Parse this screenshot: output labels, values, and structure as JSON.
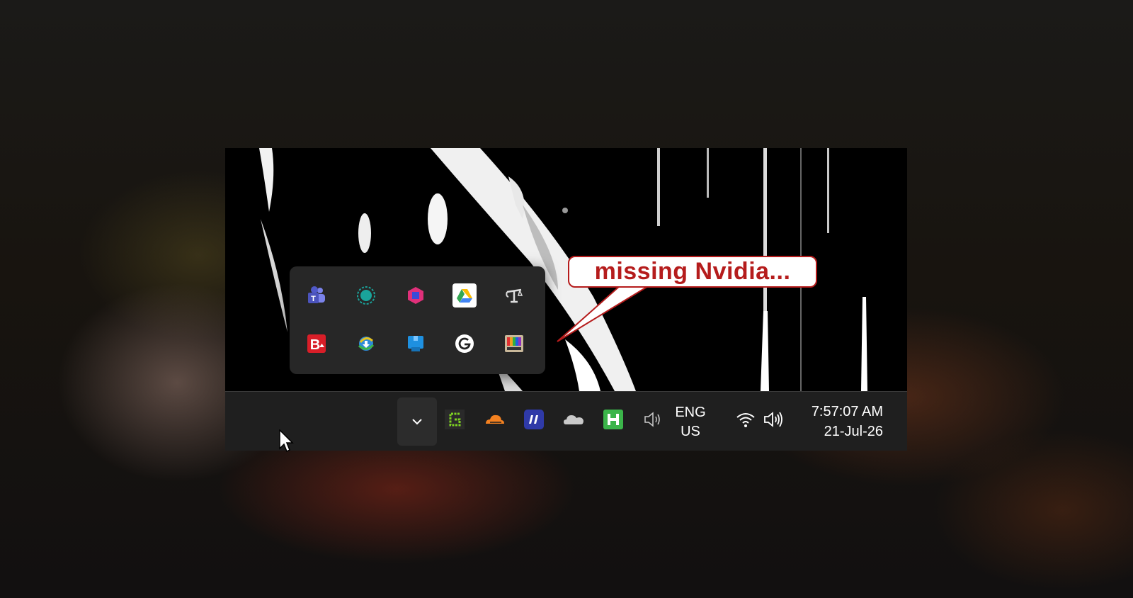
{
  "popup": {
    "icons": [
      {
        "name": "microsoft-teams-icon"
      },
      {
        "name": "circle-app-icon"
      },
      {
        "name": "pink-cube-app-icon"
      },
      {
        "name": "google-drive-icon"
      },
      {
        "name": "scale-app-icon"
      },
      {
        "name": "red-b-app-icon"
      },
      {
        "name": "internet-download-manager-icon"
      },
      {
        "name": "blue-app-icon"
      },
      {
        "name": "grammarly-icon"
      },
      {
        "name": "color-bars-app-icon"
      }
    ]
  },
  "annotation": {
    "text": "missing Nvidia..."
  },
  "taskbar": {
    "tray_icons": [
      {
        "name": "chevron-down-icon"
      },
      {
        "name": "green-g-app-icon"
      },
      {
        "name": "cloudflare-icon"
      },
      {
        "name": "quote-app-icon"
      },
      {
        "name": "onedrive-cloud-icon"
      },
      {
        "name": "green-h-app-icon"
      },
      {
        "name": "speaker-icon"
      },
      {
        "name": "wifi-icon"
      },
      {
        "name": "volume-icon"
      }
    ],
    "language": {
      "line1": "ENG",
      "line2": "US"
    },
    "clock": {
      "time": "7:57:07 AM",
      "date": "21-Jul-26"
    }
  },
  "colors": {
    "annotation_red": "#b51c1c",
    "taskbar_bg": "#1f1f1f",
    "popup_bg": "#272727"
  }
}
